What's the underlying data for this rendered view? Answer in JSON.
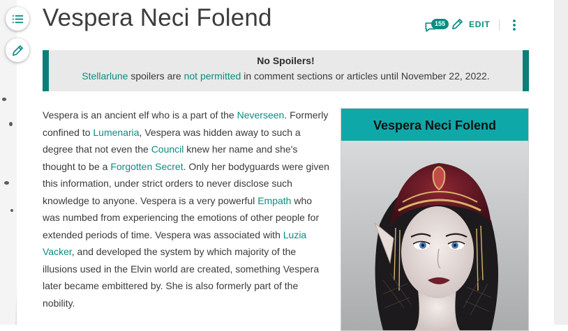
{
  "page": {
    "title": "Vespera Neci Folend"
  },
  "toolbar": {
    "comment_count": "155",
    "edit_label": "EDIT"
  },
  "notice": {
    "title": "No Spoilers!",
    "link_1": "Stellarlune",
    "text_1": " spoilers are ",
    "link_2": "not permitted",
    "text_2": " in comment sections or articles until November 22, 2022."
  },
  "article": {
    "segments": [
      {
        "t": "Vespera is an ancient elf who is a part of the ",
        "link": false
      },
      {
        "t": "Neverseen",
        "link": true
      },
      {
        "t": ". Formerly confined to ",
        "link": false
      },
      {
        "t": "Lumenaria",
        "link": true
      },
      {
        "t": ", Vespera was hidden away to such a degree that not even the ",
        "link": false
      },
      {
        "t": "Council",
        "link": true
      },
      {
        "t": " knew her name and she's thought to be a ",
        "link": false
      },
      {
        "t": "Forgotten Secret",
        "link": true
      },
      {
        "t": ". Only her bodyguards were given this information, under strict orders to never disclose such knowledge to anyone. Vespera is a very powerful ",
        "link": false
      },
      {
        "t": "Empath",
        "link": true
      },
      {
        "t": " who was numbed from experiencing the emotions of other people for extended periods of time. Vespera was associated with ",
        "link": false
      },
      {
        "t": "Luzia Vacker",
        "link": true
      },
      {
        "t": ", and developed the system by which majority of the illusions used in the Elvin world are created, something Vespera later became embittered by. She is also formerly part of the nobility.",
        "link": false
      }
    ]
  },
  "infobox": {
    "title": "Vespera Neci Folend"
  },
  "colors": {
    "accent": "#0b8c83",
    "notice_border": "#0b7f78",
    "infobox_header": "#0fa8a9"
  },
  "icons": {
    "toc": "list-icon",
    "edit_fab": "pencil-icon",
    "comments": "comment-icon",
    "edit": "pencil-icon",
    "more": "more-vertical-icon"
  }
}
